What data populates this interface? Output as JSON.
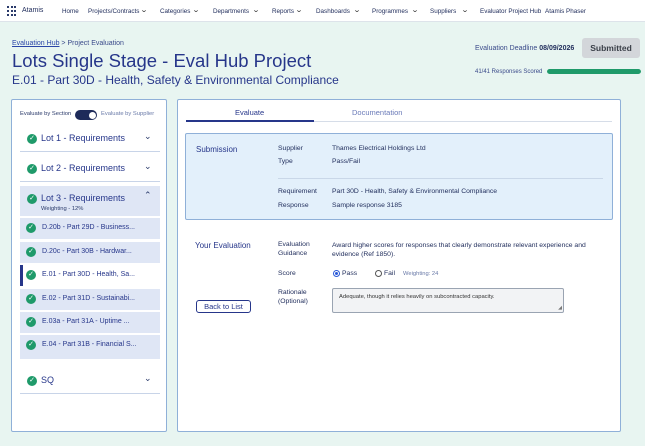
{
  "nav": {
    "brand": "Atamis",
    "items": [
      "Home",
      "Projects/Contracts",
      "Categories",
      "Departments",
      "Reports",
      "Dashboards",
      "Programmes",
      "Suppliers",
      "Evaluator Project Hub",
      "Atamis Phaser"
    ]
  },
  "header": {
    "breadcrumb_link": "Evaluation Hub",
    "breadcrumb_sep": " > ",
    "breadcrumb_current": "Project Evaluation",
    "title": "Lots Single Stage - Eval Hub Project",
    "subtitle": "E.01 - Part 30D - Health, Safety & Environmental Compliance",
    "deadline_label": "Evaluation Deadline",
    "deadline_value": "08/09/2026",
    "status_button": "Submitted",
    "responses_scored": "41/41 Responses Scored",
    "progress_fraction": 1.0
  },
  "sidebar": {
    "toggle_left": "Evaluate by Section",
    "toggle_right": "Evaluate by Supplier",
    "lots": [
      {
        "label": "Lot 1 - Requirements"
      },
      {
        "label": "Lot 2 - Requirements"
      },
      {
        "label": "Lot 3 - Requirements",
        "weighting": "Weighting - 12%"
      },
      {
        "label": "SQ"
      }
    ],
    "lot3_items": [
      "D.20b - Part 29D - Business...",
      "D.20c - Part 30B - Hardwar...",
      "E.01 - Part 30D - Health, Sa...",
      "E.02 - Part 31D - Sustainabi...",
      "E.03a - Part 31A - Uptime ...",
      "E.04 - Part 31B - Financial S..."
    ]
  },
  "tabs": {
    "evaluate": "Evaluate",
    "documentation": "Documentation"
  },
  "submission": {
    "title": "Submission",
    "supplier_label": "Supplier",
    "supplier_value": "Thames Electrical Holdings Ltd",
    "type_label": "Type",
    "type_value": "Pass/Fail",
    "requirement_label": "Requirement",
    "requirement_value": "Part 30D - Health, Safety & Environmental Compliance",
    "response_label": "Response",
    "response_value": "Sample response 3185"
  },
  "evaluation": {
    "title": "Your Evaluation",
    "guidance_label_1": "Evaluation",
    "guidance_label_2": "Guidance",
    "guidance_text": "Award higher scores for responses that clearly demonstrate relevant experience and evidence (Ref 1850).",
    "score_label": "Score",
    "pass_label": "Pass",
    "fail_label": "Fail",
    "weighting": "Weighting: 24",
    "rationale_label_1": "Rationale",
    "rationale_label_2": "(Optional)",
    "rationale_text": "Adequate, though it relies heavily on subcontracted capacity.",
    "back_button": "Back to List"
  }
}
